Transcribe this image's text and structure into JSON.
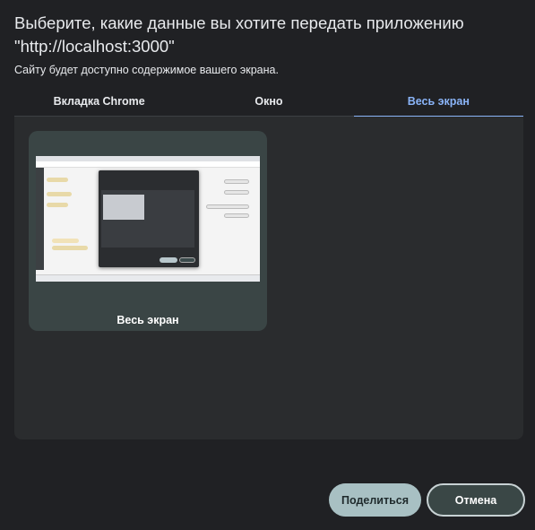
{
  "dialog": {
    "title": "Выберите, какие данные вы хотите передать приложению \"http://localhost:3000\"",
    "subtitle": "Сайту будет доступно содержимое вашего экрана."
  },
  "tabs": [
    {
      "label": "Вкладка Chrome",
      "active": false
    },
    {
      "label": "Окно",
      "active": false
    },
    {
      "label": "Весь экран",
      "active": true
    }
  ],
  "sources": [
    {
      "label": "Весь экран",
      "selected": true
    }
  ],
  "buttons": {
    "share": "Поделиться",
    "cancel": "Отмена"
  },
  "colors": {
    "background": "#202124",
    "panel": "#2a2c2e",
    "card": "#3a4545",
    "accent": "#8ab4f8",
    "share_button": "#a8c0c3",
    "cancel_button": "#3a4746"
  }
}
